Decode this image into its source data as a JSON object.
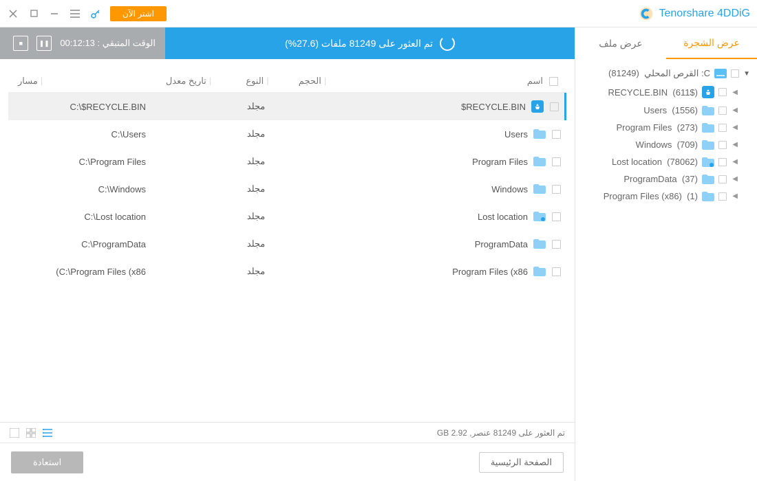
{
  "app": {
    "title": "Tenorshare 4DDiG",
    "buy": "اشتر الآن"
  },
  "tabs": {
    "tree": "عرض الشجرة",
    "file": "عرض ملف"
  },
  "tree": {
    "root": {
      "label": "C: القرص المحلي",
      "count": "(81249)"
    },
    "items": [
      {
        "label": "RECYCLE.BIN",
        "count": "(611$",
        "icon": "recycle"
      },
      {
        "label": "Users",
        "count": "(1556",
        "icon": "folder"
      },
      {
        "label": "Program Files",
        "count": "(273",
        "icon": "folder"
      },
      {
        "label": "Windows",
        "count": "(709",
        "icon": "folder"
      },
      {
        "label": "Lost location",
        "count": "(78062",
        "icon": "folder-sp"
      },
      {
        "label": "ProgramData",
        "count": "(37",
        "icon": "folder"
      },
      {
        "label": "Program Files (x86)",
        "count": "(1",
        "icon": "folder"
      }
    ]
  },
  "status": {
    "text": "تم العثور على 81249 ملفات (27.6%)",
    "time_label": "الوقت المتبقي :",
    "time_value": "00:12:13"
  },
  "table": {
    "headers": {
      "name": "اسم",
      "size": "الحجم",
      "type": "النوع",
      "date": "تاريخ معدل",
      "path": "مسار"
    },
    "rows": [
      {
        "name": "RECYCLE.BIN$",
        "type": "مجلد",
        "path": "C:\\$RECYCLE.BIN",
        "icon": "recycle",
        "sel": true
      },
      {
        "name": "Users",
        "type": "مجلد",
        "path": "C:\\Users",
        "icon": "folder"
      },
      {
        "name": "Program Files",
        "type": "مجلد",
        "path": "C:\\Program Files",
        "icon": "folder"
      },
      {
        "name": "Windows",
        "type": "مجلد",
        "path": "C:\\Windows",
        "icon": "folder"
      },
      {
        "name": "Lost location",
        "type": "مجلد",
        "path": "C:\\Lost location",
        "icon": "folder-sp"
      },
      {
        "name": "ProgramData",
        "type": "مجلد",
        "path": "C:\\ProgramData",
        "icon": "folder"
      },
      {
        "name": "Program Files (x86",
        "type": "مجلد",
        "path": "(C:\\Program Files (x86",
        "icon": "folder"
      }
    ]
  },
  "summary": "تم العثور على 81249 عنصر, GB 2.92",
  "actions": {
    "home": "الصفحة الرئيسية",
    "recover": "استعادة"
  }
}
